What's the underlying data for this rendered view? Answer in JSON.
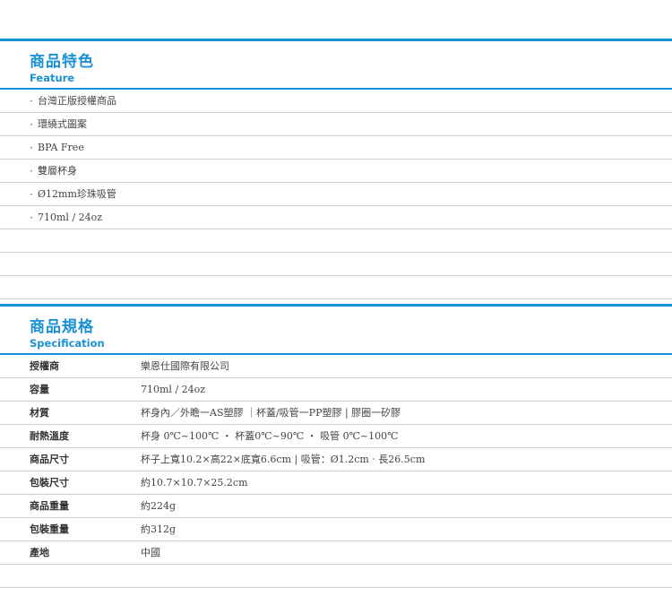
{
  "feature": {
    "title": "商品特色",
    "subtitle": "Feature",
    "bullet": "‧",
    "items": [
      "台灣正版授權商品",
      "環繞式圖案",
      "BPA Free",
      "雙層杯身",
      "Ø12mm珍珠吸管",
      "710ml / 24oz",
      "",
      "",
      ""
    ]
  },
  "spec": {
    "title": "商品規格",
    "subtitle": "Specification",
    "rows": [
      {
        "label": "授權商",
        "value": "樂恩仕國際有限公司"
      },
      {
        "label": "容量",
        "value": "710ml / 24oz"
      },
      {
        "label": "材質",
        "value": "杯身內／外瞻一AS塑膠 ｜杯蓋/吸管一PP塑膠 | 膠圈一矽膠"
      },
      {
        "label": "耐熱溫度",
        "value": "杯身 0℃~100℃ ‧ 杯蓋0℃~90℃ ‧ 吸管 0℃~100℃"
      },
      {
        "label": "商品尺寸",
        "value": "杯子上寬10.2×高22×底寬6.6cm | 吸管：Ø1.2cm ‧ 長26.5cm"
      },
      {
        "label": "包裝尺寸",
        "value": "約10.7×10.7×25.2cm"
      },
      {
        "label": "商品重量",
        "value": "約224g"
      },
      {
        "label": "包裝重量",
        "value": "約312g"
      },
      {
        "label": "產地",
        "value": "中國"
      },
      {
        "label": "",
        "value": ""
      }
    ]
  },
  "colors": {
    "accent": "#1a90d6",
    "divider": "#cfcfcf"
  }
}
